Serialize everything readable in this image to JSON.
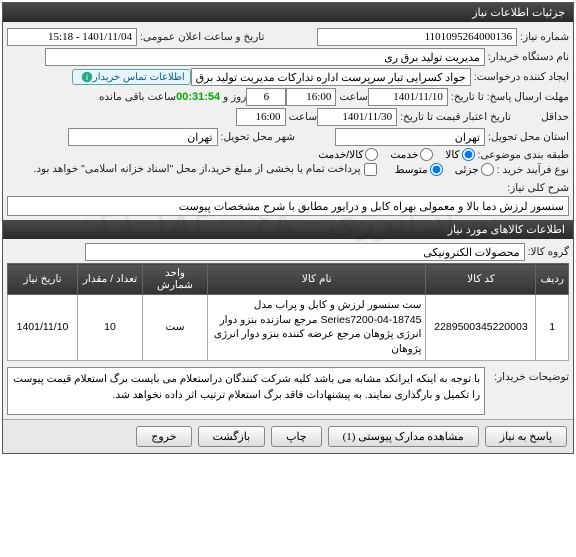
{
  "panel_title": "جزئیات اطلاعات نیاز",
  "fields": {
    "need_no_label": "شماره نیاز:",
    "need_no": "1101095264000136",
    "announce_label": "تاریخ و ساعت اعلان عمومی:",
    "announce_val": "1401/11/04 - 15:18",
    "buyer_label": "نام دستگاه خریدار:",
    "buyer_val": "مدیریت تولید برق ری",
    "creator_label": "ایجاد کننده درخواست:",
    "creator_val": "جواد کسرایی تبار سرپرست اداره تدارکات مدیریت تولید برق ری",
    "contact_badge": "اطلاعات تماس خریدار",
    "deadline_label": "مهلت ارسال پاسخ: تا تاریخ:",
    "deadline_date": "1401/11/10",
    "time_label": "ساعت",
    "deadline_time": "16:00",
    "days_label": "روز و",
    "days_val": "6",
    "remain_time": "00:31:54",
    "remain_label": "ساعت باقی مانده",
    "min_label": "حداقل",
    "validity_label": "تاریخ اعتبار قیمت تا تاریخ:",
    "validity_date": "1401/11/30",
    "validity_time": "16:00",
    "loc_label": "استان محل تحویل:",
    "loc_val": "تهران",
    "city_label": "شهر محل تحویل:",
    "city_val": "تهران",
    "class_label": "طبقه بندی موضوعی:",
    "class_goods": "کالا",
    "class_service": "خدمت",
    "class_both": "کالا/خدمت",
    "process_label": "نوع فرآیند خرید :",
    "process_small": "جزئی",
    "process_med": "متوسط",
    "pay_note": "پرداخت تمام یا بخشی از مبلغ خرید،از محل \"اسناد خزانه اسلامی\" خواهد بود.",
    "desc_label": "شرح کلی نیاز:",
    "desc_val": "سنسور لرزش دما بالا و معمولی بهراه کابل و درایور مطابق با شرح مشخصات پیوست",
    "items_title": "اطلاعات کالاهای مورد نیاز",
    "group_label": "گروه کالا:",
    "group_val": "محصولات الکترونیکی",
    "buyer_desc_label": "توضیحات خریدار:",
    "buyer_desc_val": "با توجه به اینکه ایرانکد مشابه می باشد کلیه شرکت کنندگان دراستعلام می بایست برگ استعلام قیمت پیوست را تکمیل و بارگذاری نمایند. به پیشنهادات فاقد برگ استعلام ترتیب اثر داده نخواهد شد."
  },
  "table": {
    "headers": [
      "ردیف",
      "کد کالا",
      "نام کالا",
      "واحد شمارش",
      "تعداد / مقدار",
      "تاریخ نیاز"
    ],
    "rows": [
      {
        "idx": "1",
        "code": "2289500345220003",
        "name": "ست سنسور لرزش و کابل و پراب مدل Series7200-04-18745 مرجع سازنده بنزو دوار انرژی پژوهان مرجع عرضه کننده بنزو دوار انرژی پژوهان",
        "unit": "ست",
        "qty": "10",
        "date": "1401/11/10"
      }
    ]
  },
  "buttons": {
    "respond": "پاسخ به نیاز",
    "view_attach": "مشاهده مدارک پیوستی (1)",
    "print": "چاپ",
    "back": "بازگشت",
    "exit": "خروج"
  },
  "watermark": "ستاد انرژی - ۱۸۴۰۰۶۸-۰۲۱"
}
